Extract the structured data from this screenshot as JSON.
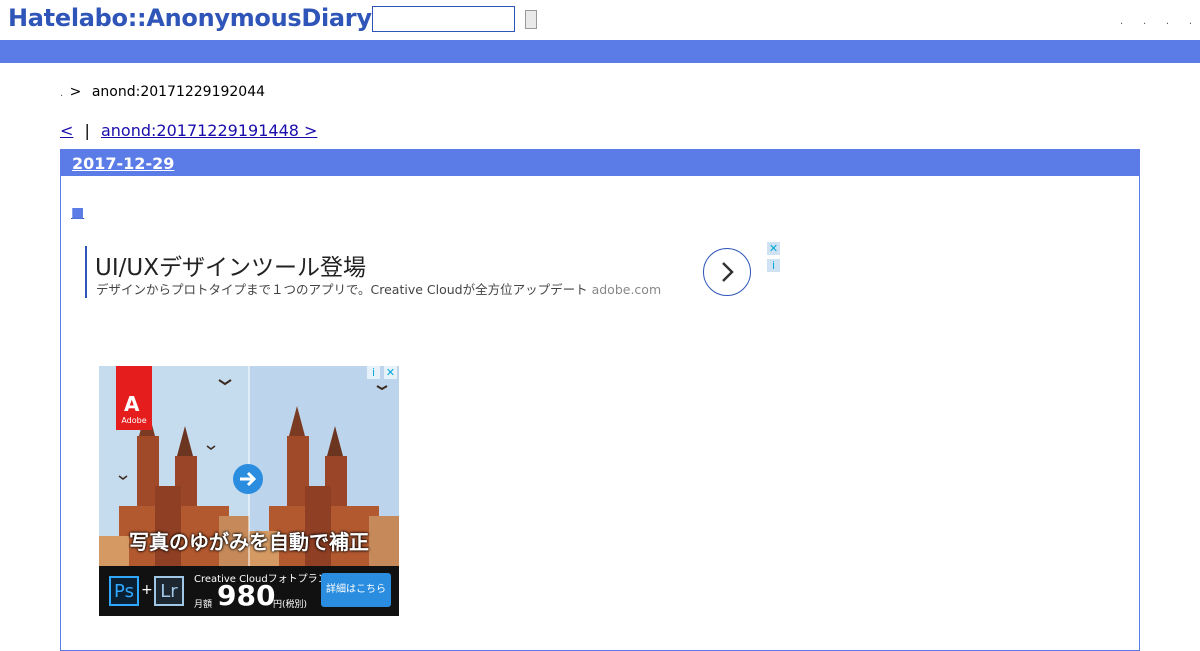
{
  "header": {
    "logo": "Hatelabo::AnonymousDiary",
    "search_placeholder": "",
    "top_links": [
      ".",
      ".",
      ".",
      "."
    ]
  },
  "breadcrumb": {
    "home": ".",
    "separator": ">",
    "current": "anond:20171229192044"
  },
  "nav": {
    "prev": "<",
    "separator": "|",
    "next": "anond:20171229191448 >"
  },
  "day": {
    "date": "2017-12-29",
    "entry_marker": "■"
  },
  "text_ad": {
    "headline": "UI/UXデザインツール登場",
    "description": "デザインからプロトタイプまで１つのアプリで。Creative Cloudが全方位アップデート",
    "domain": "adobe.com",
    "close": "✕",
    "info": "i"
  },
  "banner_ad": {
    "brand": "Adobe",
    "caption": "写真のゆがみを自動で補正",
    "ps": "Ps",
    "plus": "+",
    "lr": "Lr",
    "plan": "Creative Cloudフォトプラン",
    "monthly": "月額",
    "price": "980",
    "tax": "円(税別)",
    "cta": "詳細はこちら",
    "close": "✕",
    "info": "i"
  },
  "colors": {
    "brand_blue": "#2f55b8",
    "bar_blue": "#5b7be6",
    "adobe_red": "#e61d1d",
    "cta_blue": "#2a8de0"
  }
}
